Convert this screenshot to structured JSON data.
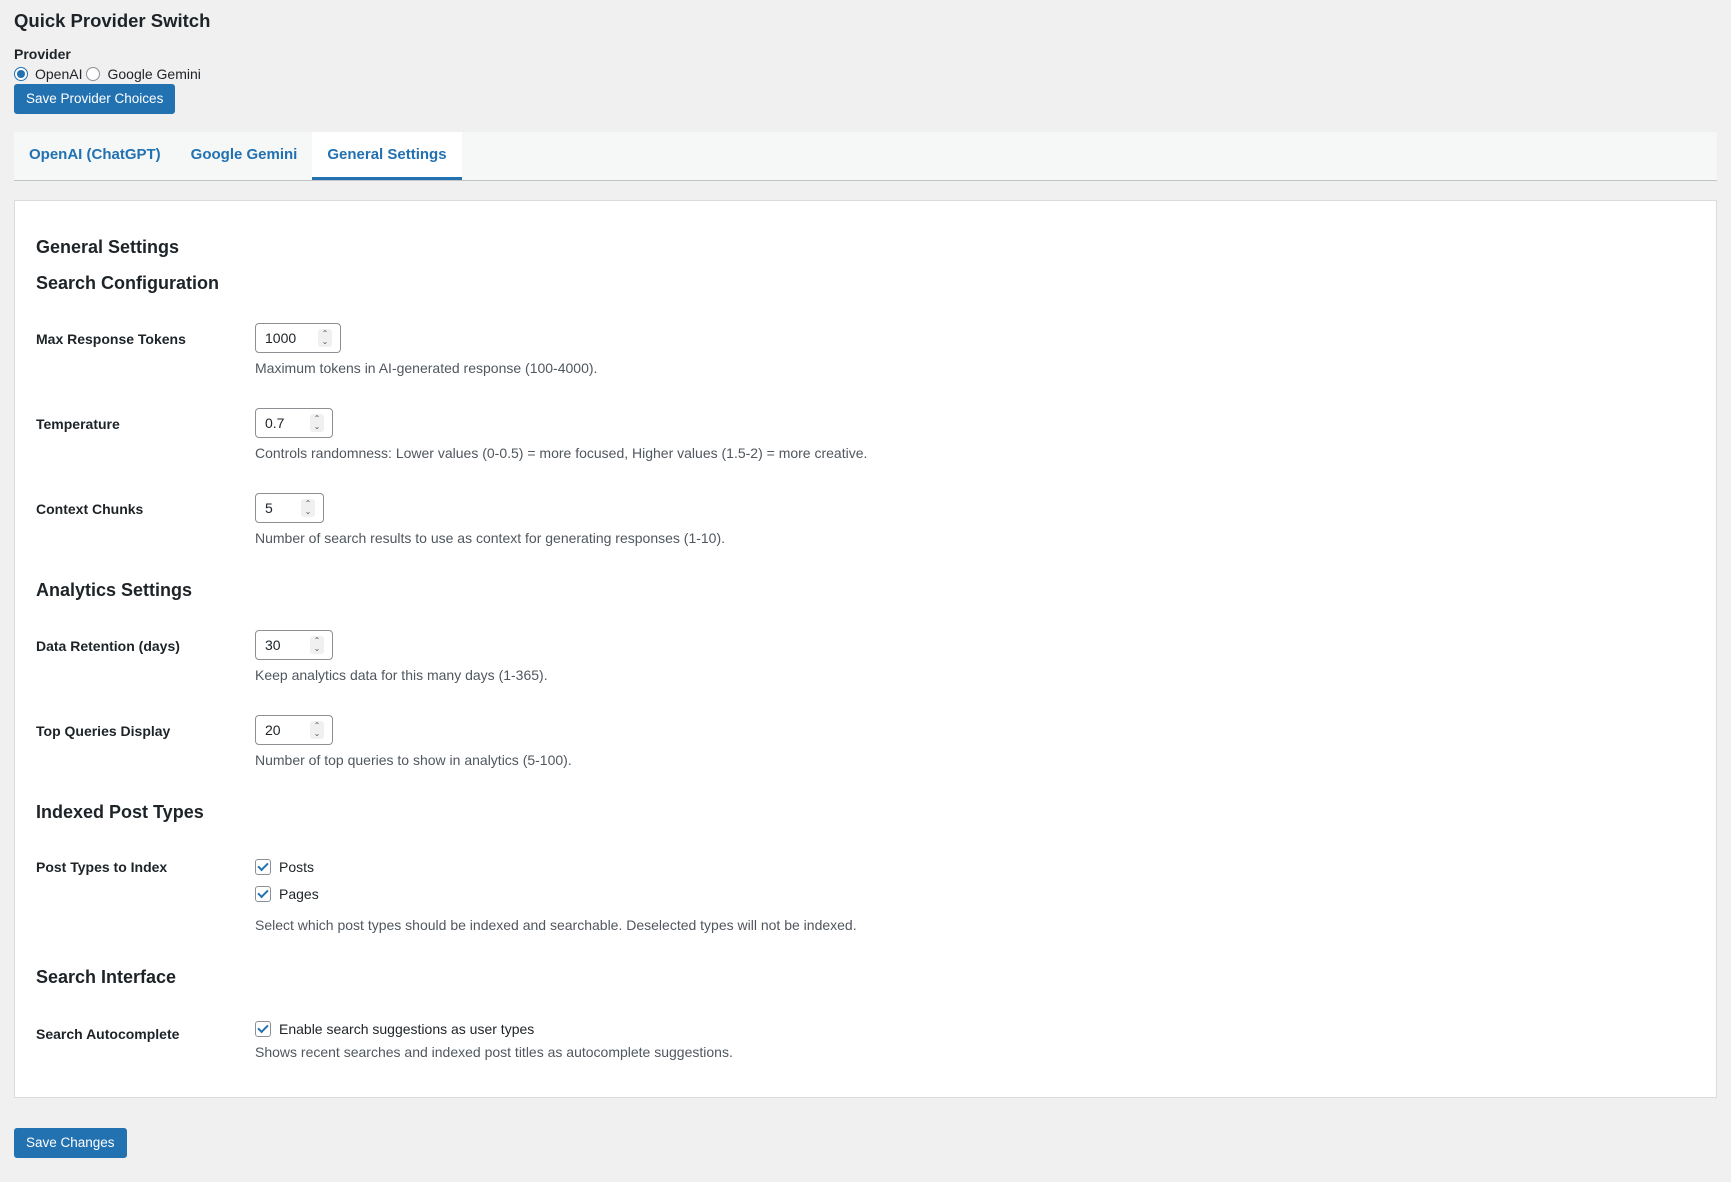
{
  "quick_switch": {
    "title": "Quick Provider Switch",
    "provider_label": "Provider",
    "options": [
      {
        "label": "OpenAI",
        "checked": true
      },
      {
        "label": "Google Gemini",
        "checked": false
      }
    ],
    "save_label": "Save Provider Choices"
  },
  "tabs": [
    {
      "label": "OpenAI (ChatGPT)",
      "active": false
    },
    {
      "label": "Google Gemini",
      "active": false
    },
    {
      "label": "General Settings",
      "active": true
    }
  ],
  "panel": {
    "heading": "General Settings",
    "search_config": {
      "heading": "Search Configuration",
      "max_tokens": {
        "label": "Max Response Tokens",
        "value": "1000",
        "desc": "Maximum tokens in AI-generated response (100-4000)."
      },
      "temperature": {
        "label": "Temperature",
        "value": "0.7",
        "desc": "Controls randomness: Lower values (0-0.5) = more focused, Higher values (1.5-2) = more creative."
      },
      "context_chunks": {
        "label": "Context Chunks",
        "value": "5",
        "desc": "Number of search results to use as context for generating responses (1-10)."
      }
    },
    "analytics": {
      "heading": "Analytics Settings",
      "retention": {
        "label": "Data Retention (days)",
        "value": "30",
        "desc": "Keep analytics data for this many days (1-365)."
      },
      "top_queries": {
        "label": "Top Queries Display",
        "value": "20",
        "desc": "Number of top queries to show in analytics (5-100)."
      }
    },
    "indexed": {
      "heading": "Indexed Post Types",
      "label": "Post Types to Index",
      "posts": {
        "label": "Posts",
        "checked": true
      },
      "pages": {
        "label": "Pages",
        "checked": true
      },
      "desc": "Select which post types should be indexed and searchable. Deselected types will not be indexed."
    },
    "interface": {
      "heading": "Search Interface",
      "label": "Search Autocomplete",
      "checkbox": {
        "label": "Enable search suggestions as user types",
        "checked": true
      },
      "desc": "Shows recent searches and indexed post titles as autocomplete suggestions."
    }
  },
  "save_changes_label": "Save Changes",
  "colors": {
    "accent": "#2271b1",
    "background": "#f0f0f1",
    "panel": "#ffffff"
  }
}
